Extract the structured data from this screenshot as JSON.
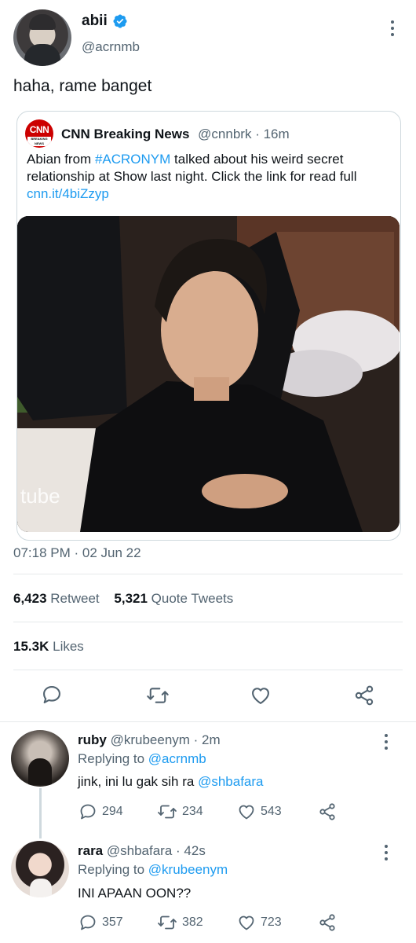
{
  "main_tweet": {
    "author_name": "abii",
    "author_handle": "@acrnmb",
    "text": "haha, rame banget",
    "timestamp": "07:18 PM · 02 Jun 22"
  },
  "quoted_tweet": {
    "logo_text": "CNN",
    "logo_subtext": "BREAKING NEWS",
    "author_name": "CNN Breaking News",
    "author_handle": "@cnnbrk",
    "time": "· 16m",
    "text_prefix": "Abian from ",
    "hashtag": "#ACRONYM",
    "text_rest": " talked about his weird secret relationship at Show last night. Click the link for read full ",
    "link": "cnn.it/4biZzyp",
    "image_watermark": "tube"
  },
  "stats": {
    "retweets_count": "6,423",
    "retweets_label": "Retweet",
    "quotes_count": "5,321",
    "quotes_label": "Quote Tweets",
    "likes_count": "15.3K",
    "likes_label": "Likes"
  },
  "actions": [
    "comment-icon",
    "retweet-icon",
    "like-icon",
    "share-icon"
  ],
  "replies": [
    {
      "name": "ruby",
      "handle": "@krubeenym",
      "time": "· 2m",
      "replying_label": "Replying to ",
      "replying_to": "@acrnmb",
      "text": "jink, ini lu gak sih ra ",
      "mention": "@shbafara",
      "replies": "294",
      "retweets": "234",
      "likes": "543"
    },
    {
      "name": "rara",
      "handle": "@shbafara",
      "time": "· 42s",
      "replying_label": "Replying to ",
      "replying_to": "@krubeenym",
      "text": "INI APAAN OON??",
      "mention": "",
      "replies": "357",
      "retweets": "382",
      "likes": "723"
    }
  ],
  "colors": {
    "link": "#1d9bf0",
    "muted": "#536471",
    "verified": "#1d9bf0",
    "cnn_red": "#cc0000"
  }
}
